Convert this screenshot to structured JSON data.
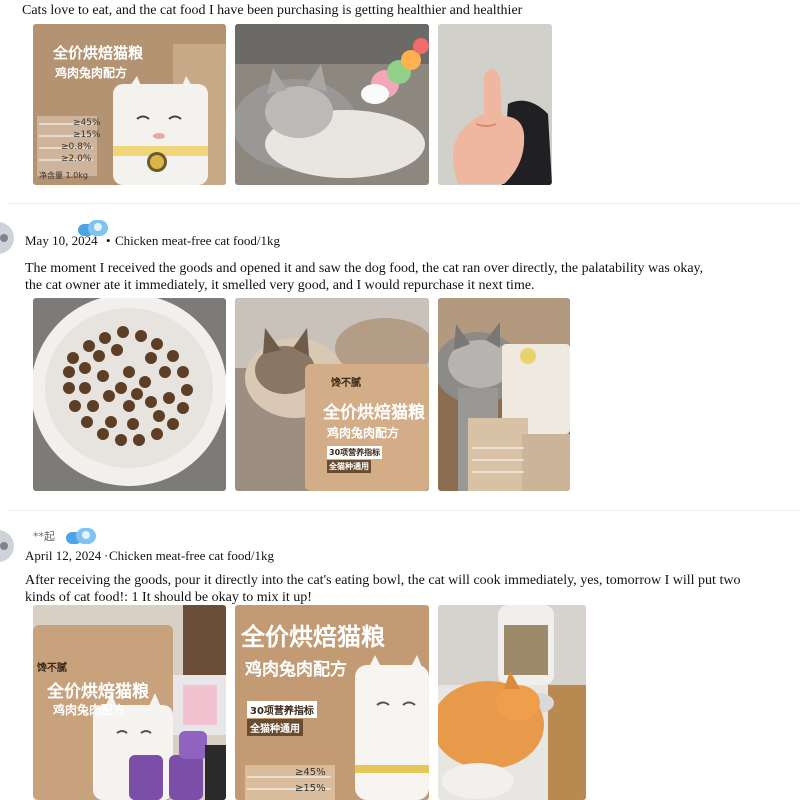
{
  "review_top": {
    "text": "Cats love to eat, and the cat food I have been purchasing is getting healthier and healthier"
  },
  "reviews": [
    {
      "date": "May 10, 2024",
      "sep": "•",
      "variant": "Chicken meat-free cat food/1kg",
      "text_line1": "The moment I received the goods and opened it and saw the dog food, the cat ran over directly, the palatability was okay,",
      "text_line2": "the cat owner ate it immediately, it smelled very good, and I would repurchase it next time."
    },
    {
      "username": "**起",
      "date": "April 12, 2024",
      "sep": "·",
      "variant": "Chicken meat-free cat food/1kg",
      "text_line1": "After receiving the goods, pour it directly into the cat's eating bowl, the cat will cook immediately, yes, tomorrow I will put two",
      "text_line2": "kinds of cat food!: 1 It should be okay to mix it up!"
    }
  ],
  "package": {
    "brand": "馋不腻",
    "title": "全价烘焙猫粮",
    "subtitle": "鸡肉兔肉配方",
    "tag1": "30项营养指标",
    "tag2": "全猫种通用",
    "v1": "≥45%",
    "v2": "≥15%",
    "v3": "≥0.8%",
    "v4": "≥2.0%",
    "weight": "净含量 1.0kg"
  }
}
